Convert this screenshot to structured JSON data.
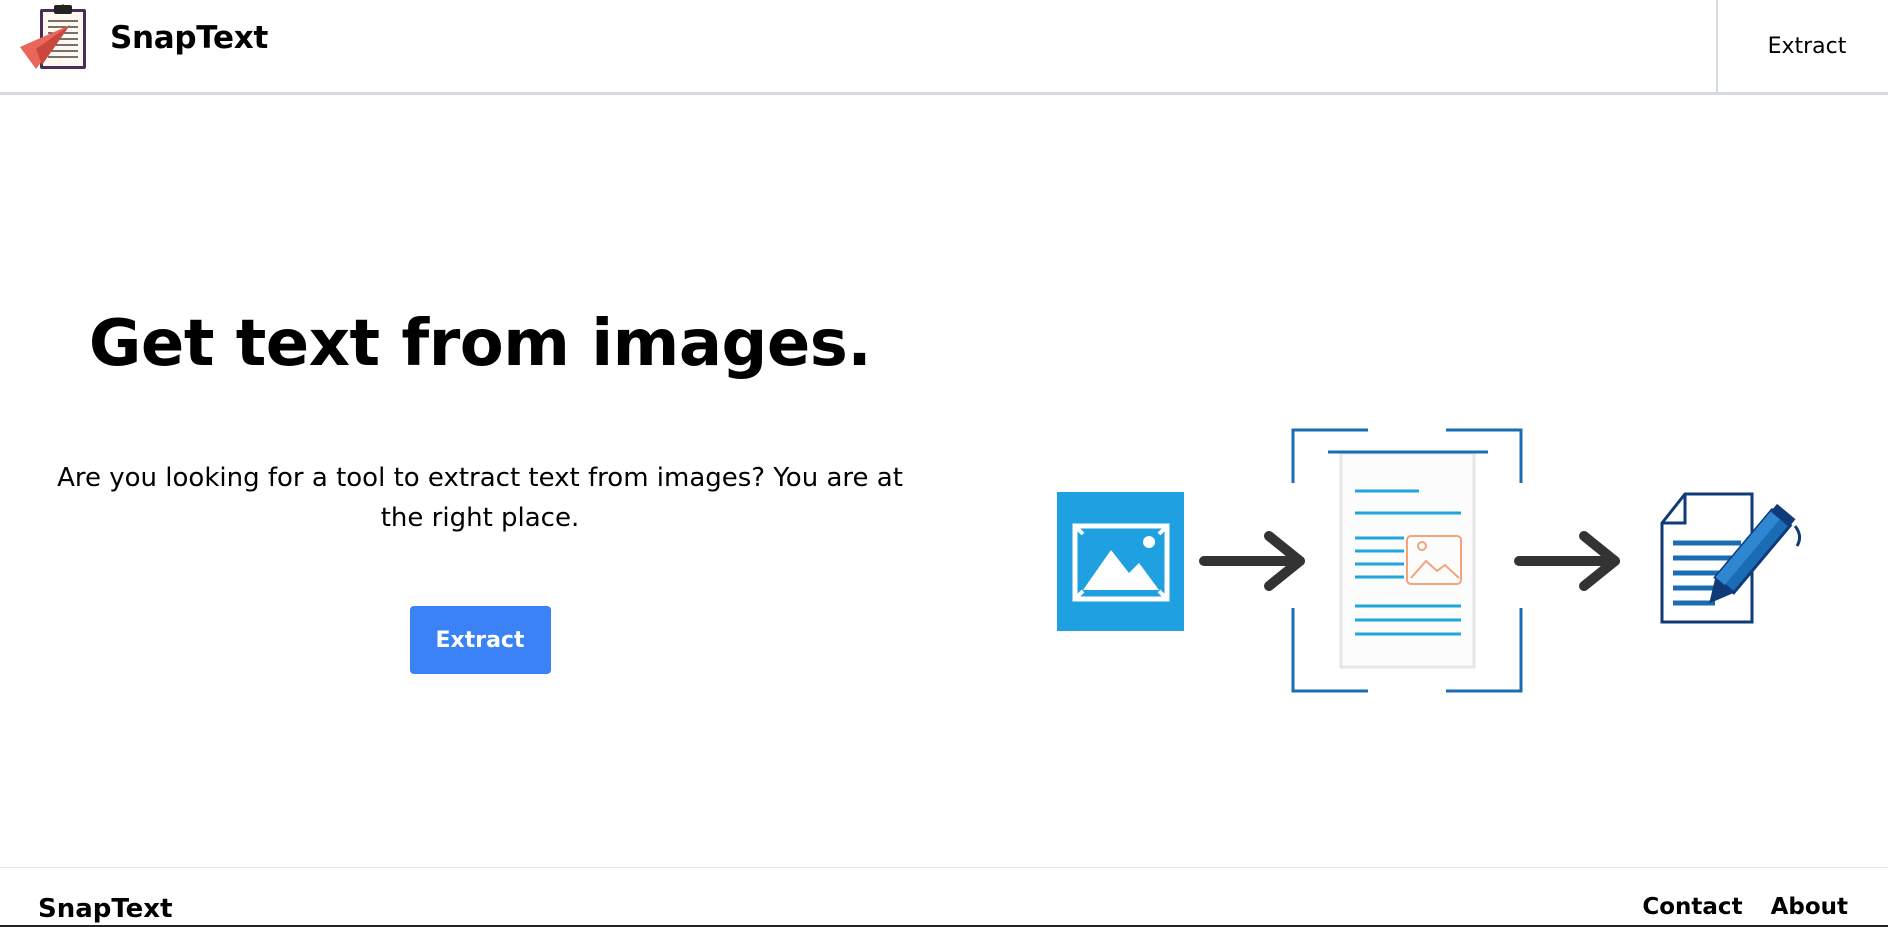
{
  "header": {
    "brand_name": "SnapText",
    "nav_extract": "Extract"
  },
  "hero": {
    "title": "Get text from images.",
    "description": "Are you looking for a tool to extract text from images? You are at the right place.",
    "cta_label": "Extract"
  },
  "footer": {
    "brand_name": "SnapText",
    "links": [
      "Contact",
      "About"
    ]
  },
  "icons": {
    "logo": "clipboard-paper-plane-icon",
    "illustration": [
      "image-icon",
      "arrow-right-icon",
      "scanned-document-icon",
      "arrow-right-icon",
      "edit-document-icon"
    ]
  },
  "colors": {
    "accent": "#3b82f6",
    "image_tile": "#1fa0e0",
    "doc_frame": "#1a6db5",
    "arrow": "#333333",
    "logo_red": "#e8675a"
  }
}
